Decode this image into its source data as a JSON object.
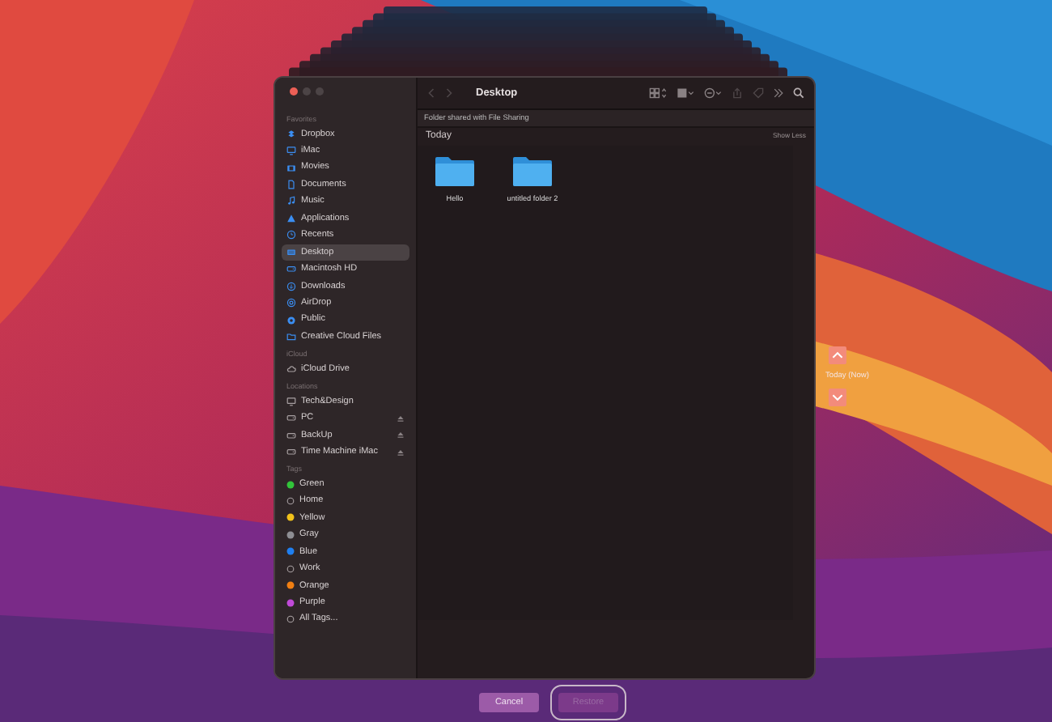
{
  "sidebar": {
    "sections": [
      {
        "title": "Favorites",
        "kind": "places",
        "items": [
          {
            "label": "Dropbox",
            "kind": "dropbox",
            "selected": false
          },
          {
            "label": "iMac",
            "kind": "computer",
            "selected": false
          },
          {
            "label": "Movies",
            "kind": "movies",
            "selected": false
          },
          {
            "label": "Documents",
            "kind": "document",
            "selected": false
          },
          {
            "label": "Music",
            "kind": "music",
            "selected": false
          },
          {
            "label": "Applications",
            "kind": "apps",
            "selected": false
          },
          {
            "label": "Recents",
            "kind": "recents",
            "selected": false
          },
          {
            "label": "Desktop",
            "kind": "desktop",
            "selected": true
          },
          {
            "label": "Macintosh HD",
            "kind": "disk",
            "selected": false
          },
          {
            "label": "Downloads",
            "kind": "downloads",
            "selected": false
          },
          {
            "label": "AirDrop",
            "kind": "airdrop",
            "selected": false
          },
          {
            "label": "Public",
            "kind": "public",
            "selected": false
          },
          {
            "label": "Creative Cloud Files",
            "kind": "folder",
            "selected": false
          }
        ]
      },
      {
        "title": "iCloud",
        "kind": "places",
        "items": [
          {
            "label": "iCloud Drive",
            "kind": "cloud",
            "selected": false
          }
        ]
      },
      {
        "title": "Locations",
        "kind": "places",
        "items": [
          {
            "label": "Tech&Design",
            "kind": "network",
            "selected": false,
            "ejectable": false
          },
          {
            "label": "PC",
            "kind": "drive",
            "selected": false,
            "ejectable": true
          },
          {
            "label": "BackUp",
            "kind": "drive",
            "selected": false,
            "ejectable": true
          },
          {
            "label": "Time Machine iMac",
            "kind": "drive",
            "selected": false,
            "ejectable": true
          }
        ]
      },
      {
        "title": "Tags",
        "kind": "tags",
        "items": [
          {
            "label": "Green",
            "color": "#32c43a"
          },
          {
            "label": "Home"
          },
          {
            "label": "Yellow",
            "color": "#f2c21a"
          },
          {
            "label": "Gray",
            "color": "#8e8e93"
          },
          {
            "label": "Blue",
            "color": "#1f7ff0"
          },
          {
            "label": "Work"
          },
          {
            "label": "Orange",
            "color": "#f07f12"
          },
          {
            "label": "Purple",
            "color": "#c04ad8"
          },
          {
            "label": "All Tags..."
          }
        ]
      }
    ]
  },
  "toolbar": {
    "title": "Desktop"
  },
  "banner": "Folder shared with File Sharing",
  "group": {
    "title": "Today",
    "toggle": "Show Less"
  },
  "files": [
    {
      "name": "Hello"
    },
    {
      "name": "untitled folder 2"
    }
  ],
  "timeline": {
    "label": "Today (Now)"
  },
  "buttons": [
    {
      "label": "Cancel",
      "disabled": false
    },
    {
      "label": "Restore",
      "disabled": true,
      "focused": true
    }
  ]
}
